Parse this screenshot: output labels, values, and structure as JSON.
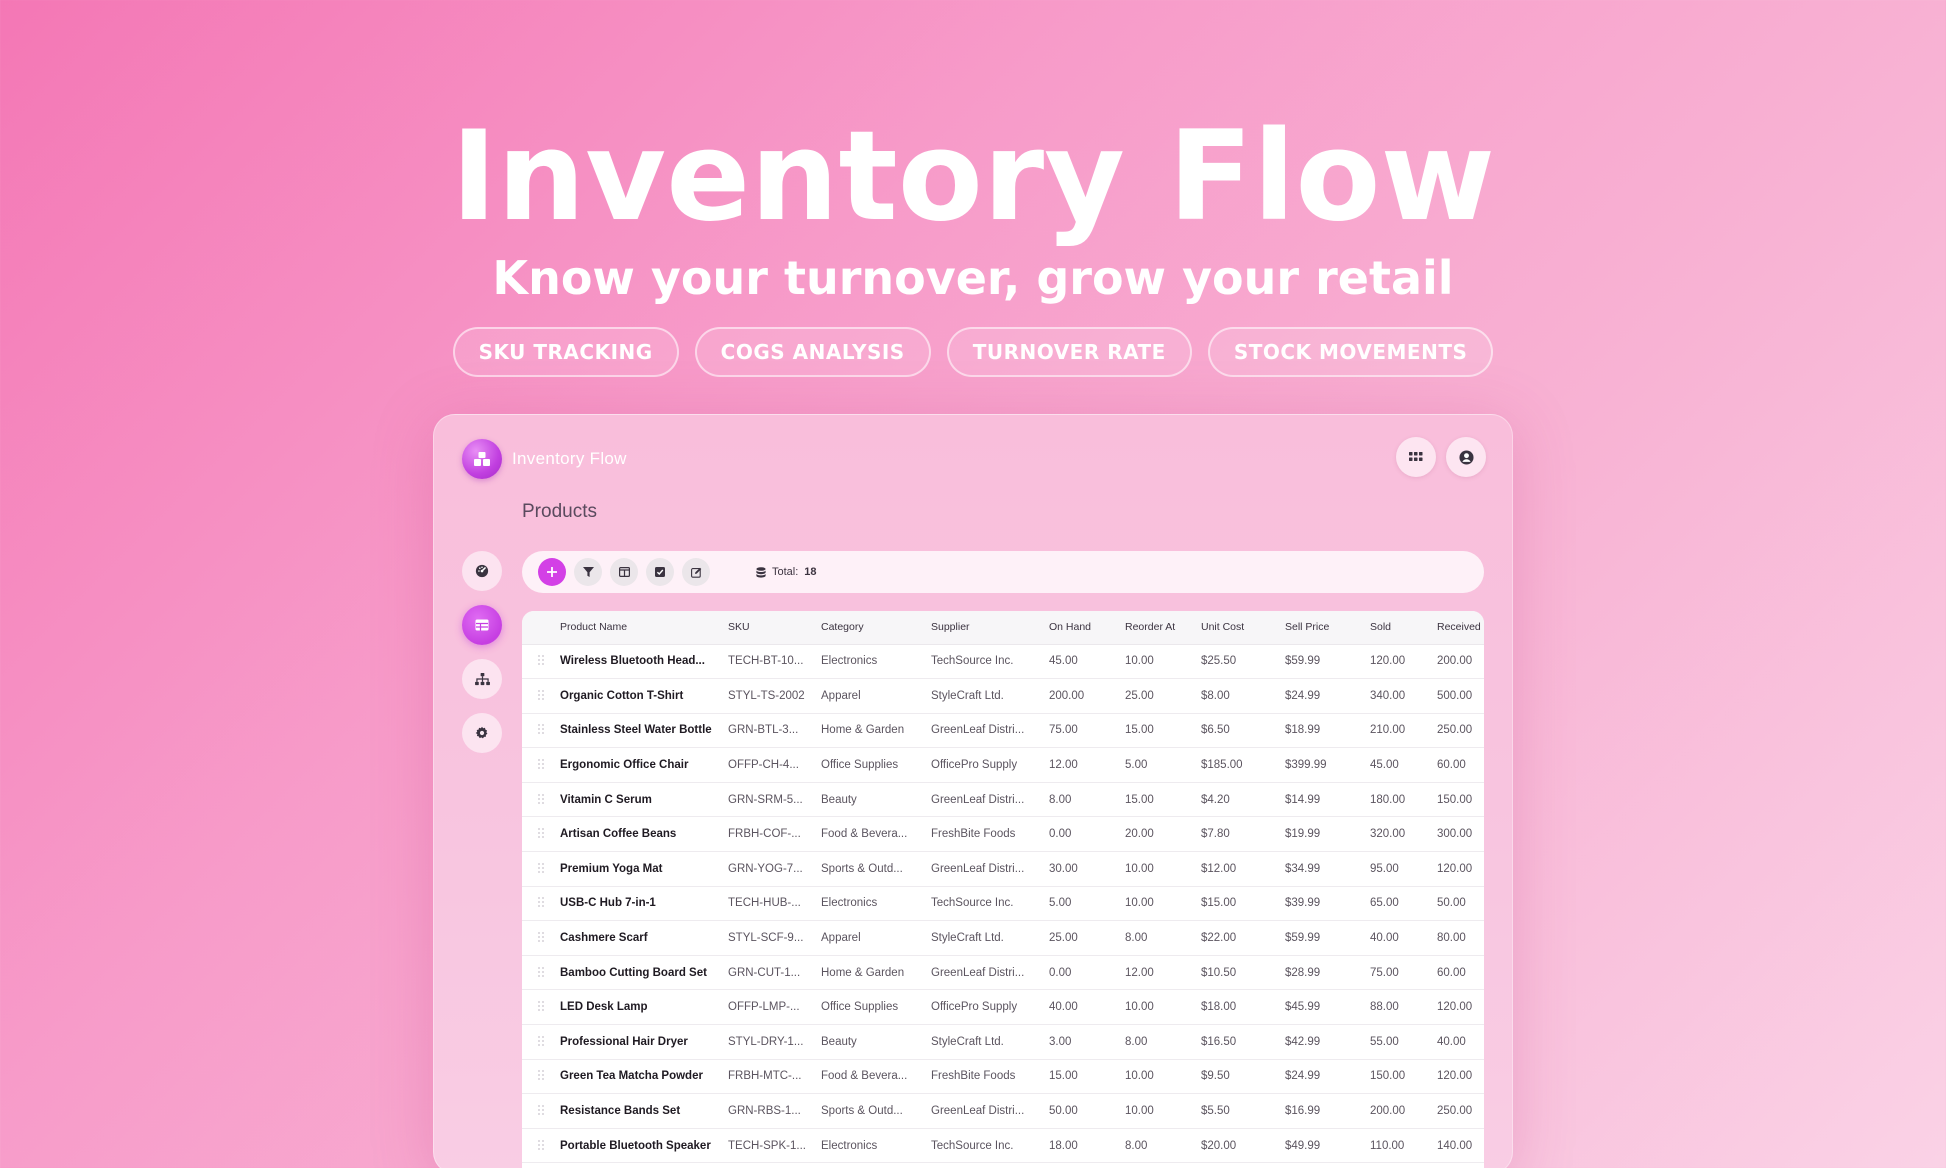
{
  "hero": {
    "title": "Inventory Flow",
    "subtitle": "Know your turnover, grow your retail",
    "pills": [
      "SKU TRACKING",
      "COGS ANALYSIS",
      "TURNOVER RATE",
      "STOCK MOVEMENTS"
    ]
  },
  "app": {
    "brand_name": "Inventory Flow",
    "page_title": "Products",
    "accent_color": "#d340e6",
    "toolbar": {
      "total_label": "Total:",
      "total_value": "18"
    },
    "table": {
      "columns": [
        "Product Name",
        "SKU",
        "Category",
        "Supplier",
        "On Hand",
        "Reorder At",
        "Unit Cost",
        "Sell Price",
        "Sold",
        "Received"
      ],
      "rows": [
        [
          "Wireless Bluetooth Head...",
          "TECH-BT-10...",
          "Electronics",
          "TechSource Inc.",
          "45.00",
          "10.00",
          "$25.50",
          "$59.99",
          "120.00",
          "200.00"
        ],
        [
          "Organic Cotton T-Shirt",
          "STYL-TS-2002",
          "Apparel",
          "StyleCraft Ltd.",
          "200.00",
          "25.00",
          "$8.00",
          "$24.99",
          "340.00",
          "500.00"
        ],
        [
          "Stainless Steel Water Bottle",
          "GRN-BTL-3...",
          "Home & Garden",
          "GreenLeaf Distri...",
          "75.00",
          "15.00",
          "$6.50",
          "$18.99",
          "210.00",
          "250.00"
        ],
        [
          "Ergonomic Office Chair",
          "OFFP-CH-4...",
          "Office Supplies",
          "OfficePro Supply",
          "12.00",
          "5.00",
          "$185.00",
          "$399.99",
          "45.00",
          "60.00"
        ],
        [
          "Vitamin C Serum",
          "GRN-SRM-5...",
          "Beauty",
          "GreenLeaf Distri...",
          "8.00",
          "15.00",
          "$4.20",
          "$14.99",
          "180.00",
          "150.00"
        ],
        [
          "Artisan Coffee Beans",
          "FRBH-COF-...",
          "Food & Bevera...",
          "FreshBite Foods",
          "0.00",
          "20.00",
          "$7.80",
          "$19.99",
          "320.00",
          "300.00"
        ],
        [
          "Premium Yoga Mat",
          "GRN-YOG-7...",
          "Sports & Outd...",
          "GreenLeaf Distri...",
          "30.00",
          "10.00",
          "$12.00",
          "$34.99",
          "95.00",
          "120.00"
        ],
        [
          "USB-C Hub 7-in-1",
          "TECH-HUB-...",
          "Electronics",
          "TechSource Inc.",
          "5.00",
          "10.00",
          "$15.00",
          "$39.99",
          "65.00",
          "50.00"
        ],
        [
          "Cashmere Scarf",
          "STYL-SCF-9...",
          "Apparel",
          "StyleCraft Ltd.",
          "25.00",
          "8.00",
          "$22.00",
          "$59.99",
          "40.00",
          "80.00"
        ],
        [
          "Bamboo Cutting Board Set",
          "GRN-CUT-1...",
          "Home & Garden",
          "GreenLeaf Distri...",
          "0.00",
          "12.00",
          "$10.50",
          "$28.99",
          "75.00",
          "60.00"
        ],
        [
          "LED Desk Lamp",
          "OFFP-LMP-...",
          "Office Supplies",
          "OfficePro Supply",
          "40.00",
          "10.00",
          "$18.00",
          "$45.99",
          "88.00",
          "120.00"
        ],
        [
          "Professional Hair Dryer",
          "STYL-DRY-1...",
          "Beauty",
          "StyleCraft Ltd.",
          "3.00",
          "8.00",
          "$16.50",
          "$42.99",
          "55.00",
          "40.00"
        ],
        [
          "Green Tea Matcha Powder",
          "FRBH-MTC-...",
          "Food & Bevera...",
          "FreshBite Foods",
          "15.00",
          "10.00",
          "$9.50",
          "$24.99",
          "150.00",
          "120.00"
        ],
        [
          "Resistance Bands Set",
          "GRN-RBS-1...",
          "Sports & Outd...",
          "GreenLeaf Distri...",
          "50.00",
          "10.00",
          "$5.50",
          "$16.99",
          "200.00",
          "250.00"
        ],
        [
          "Portable Bluetooth Speaker",
          "TECH-SPK-1...",
          "Electronics",
          "TechSource Inc.",
          "18.00",
          "8.00",
          "$20.00",
          "$49.99",
          "110.00",
          "140.00"
        ]
      ]
    }
  }
}
